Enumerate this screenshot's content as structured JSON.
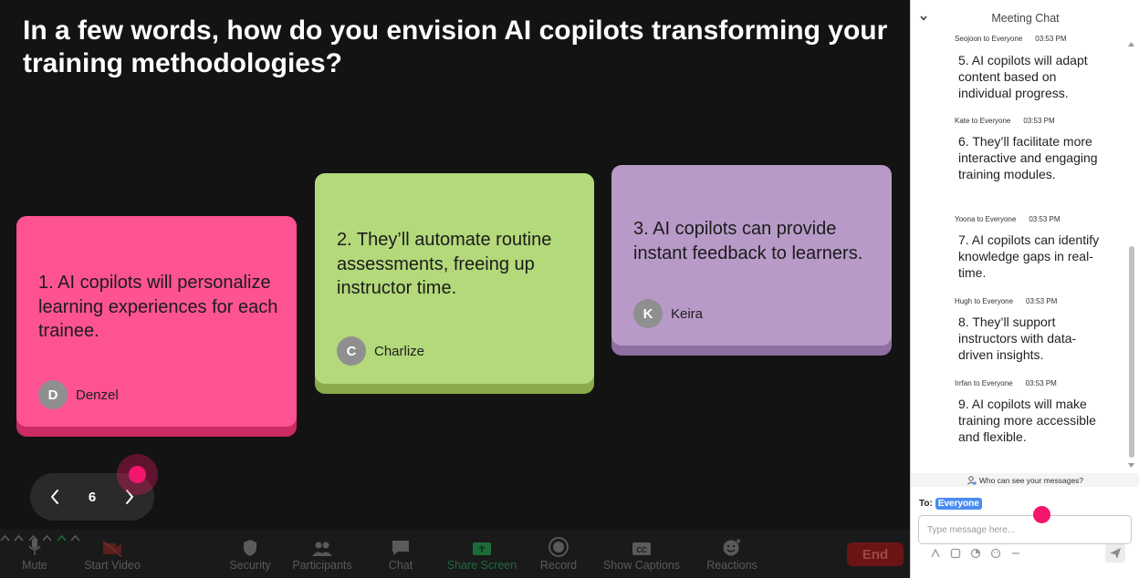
{
  "question": "In a few words, how do you envision AI copilots transforming your training methodologies?",
  "cards": [
    {
      "text": "1. AI copilots will personalize learning experiences for each trainee.",
      "initial": "D",
      "author": "Denzel",
      "color": "#fe5392"
    },
    {
      "text": "2. They’ll automate routine assessments, freeing up instructor time.",
      "initial": "C",
      "author": "Charlize",
      "color": "#b3d97b"
    },
    {
      "text": "3. AI copilots can provide instant feedback to learners.",
      "initial": "K",
      "author": "Keira",
      "color": "#b89ac8"
    }
  ],
  "pager": {
    "page": "6"
  },
  "toolbar": {
    "mute": "Mute",
    "start_video": "Start Video",
    "security": "Security",
    "participants": "Participants",
    "chat": "Chat",
    "share_screen": "Share Screen",
    "record": "Record",
    "show_captions": "Show Captions",
    "reactions": "Reactions",
    "end": "End"
  },
  "chat": {
    "title": "Meeting Chat",
    "messages": [
      {
        "meta": "Seojoon to Everyone",
        "time": "03:53 PM",
        "text": "5. AI copilots will adapt content based on individual progress."
      },
      {
        "meta": "Kate to Everyone",
        "time": "03:53 PM",
        "text": "6. They’ll facilitate more interactive and engaging training modules."
      },
      {
        "meta": "Yoona to Everyone",
        "time": "03:53 PM",
        "text": "7. AI copilots can identify knowledge gaps in real-time."
      },
      {
        "meta": "Hugh to Everyone",
        "time": "03:53 PM",
        "text": "8. They’ll support instructors with data-driven insights."
      },
      {
        "meta": "Irrfan to Everyone",
        "time": "03:53 PM",
        "text": "9. AI copilots will make training more accessible and flexible."
      }
    ],
    "who_can_see": "Who can see your messages?",
    "to_label": "To:",
    "to_value": "Everyone",
    "input_placeholder": "Type message here..."
  },
  "colors": {
    "stage_bg": "#131313",
    "accent_pointer": "#f4166c",
    "end_red": "#6b1414",
    "chip_blue": "#4a8cf0"
  }
}
